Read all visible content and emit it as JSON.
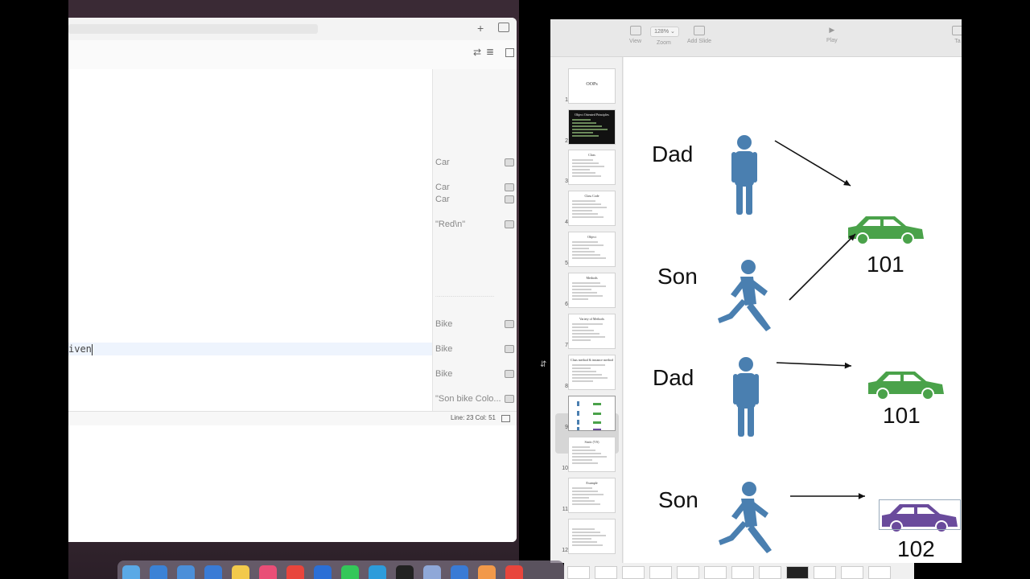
{
  "editor": {
    "code_fragment": "iven",
    "results": [
      {
        "text": "Car",
        "top": 0
      },
      {
        "text": "Car",
        "top": 0
      },
      {
        "text": "Car",
        "top": 0
      },
      {
        "text": "\"Red\\n\"",
        "top": 0
      },
      {
        "text": "Bike",
        "top": 0
      },
      {
        "text": "Bike",
        "top": 0
      },
      {
        "text": "Bike",
        "top": 0
      },
      {
        "text": "\"Son bike Colo...",
        "top": 0
      }
    ],
    "status": "Line: 23  Col: 51"
  },
  "keynote": {
    "toolbar": {
      "view": "View",
      "zoom": "Zoom",
      "zoom_value": "128%",
      "add_slide": "Add Slide",
      "play": "Play",
      "table": "Ta"
    },
    "slides": [
      {
        "n": "1",
        "title": "OOPs"
      },
      {
        "n": "2",
        "title": "Object Oriented Principles"
      },
      {
        "n": "3",
        "title": "Class"
      },
      {
        "n": "4",
        "title": "Class Code"
      },
      {
        "n": "5",
        "title": "Object"
      },
      {
        "n": "6",
        "title": "Methods"
      },
      {
        "n": "7",
        "title": "Variety of Methods"
      },
      {
        "n": "8",
        "title": "Class method & instance method"
      },
      {
        "n": "9",
        "title": ""
      },
      {
        "n": "10",
        "title": "Static (VS)"
      },
      {
        "n": "11",
        "title": "Example"
      },
      {
        "n": "12",
        "title": ""
      }
    ],
    "canvas": {
      "dad1": "Dad",
      "son1": "Son",
      "dad2": "Dad",
      "son2": "Son",
      "car1_num": "101",
      "car2_num": "101",
      "car3_num": "102",
      "colors": {
        "person": "#4a7fb0",
        "car_green": "#4aa24a",
        "car_purple": "#6a4b9c"
      }
    }
  }
}
